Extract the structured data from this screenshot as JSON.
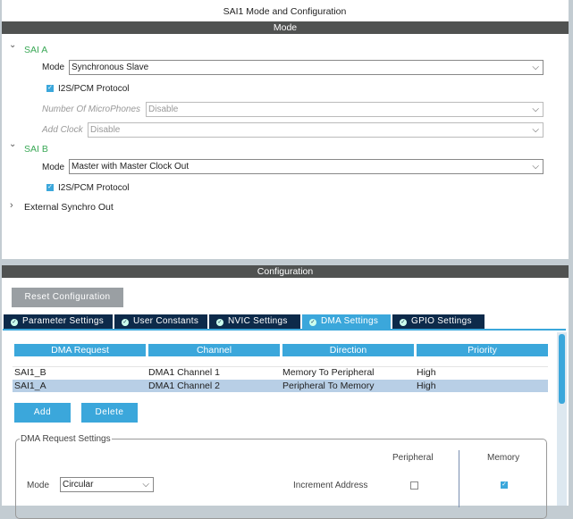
{
  "title": "SAI1 Mode and Configuration",
  "mode_header": "Mode",
  "sai_a": {
    "label": "SAI A",
    "mode_label": "Mode",
    "mode_value": "Synchronous Slave",
    "i2s_label": "I2S/PCM Protocol",
    "i2s_checked": true,
    "mics_label": "Number Of MicroPhones",
    "mics_value": "Disable",
    "clock_label": "Add Clock",
    "clock_value": "Disable"
  },
  "sai_b": {
    "label": "SAI B",
    "mode_label": "Mode",
    "mode_value": "Master with Master Clock Out",
    "i2s_label": "I2S/PCM Protocol",
    "i2s_checked": true
  },
  "ext_sync": "External Synchro Out",
  "config_header": "Configuration",
  "reset_label": "Reset Configuration",
  "tabs": [
    {
      "label": "Parameter Settings"
    },
    {
      "label": "User Constants"
    },
    {
      "label": "NVIC Settings"
    },
    {
      "label": "DMA Settings",
      "active": true
    },
    {
      "label": "GPIO Settings"
    }
  ],
  "table": {
    "headers": [
      "DMA Request",
      "Channel",
      "Direction",
      "Priority"
    ],
    "rows": [
      [
        "SAI1_B",
        "DMA1 Channel 1",
        "Memory To Peripheral",
        "High"
      ],
      [
        "SAI1_A",
        "DMA1 Channel 2",
        "Peripheral To Memory",
        "High"
      ]
    ],
    "selected_row": 1
  },
  "add_label": "Add",
  "delete_label": "Delete",
  "settings": {
    "title": "DMA Request Settings",
    "peripheral_label": "Peripheral",
    "memory_label": "Memory",
    "mode_label": "Mode",
    "mode_value": "Circular",
    "increment_label": "Increment Address",
    "inc_peripheral": false,
    "inc_memory": true
  }
}
